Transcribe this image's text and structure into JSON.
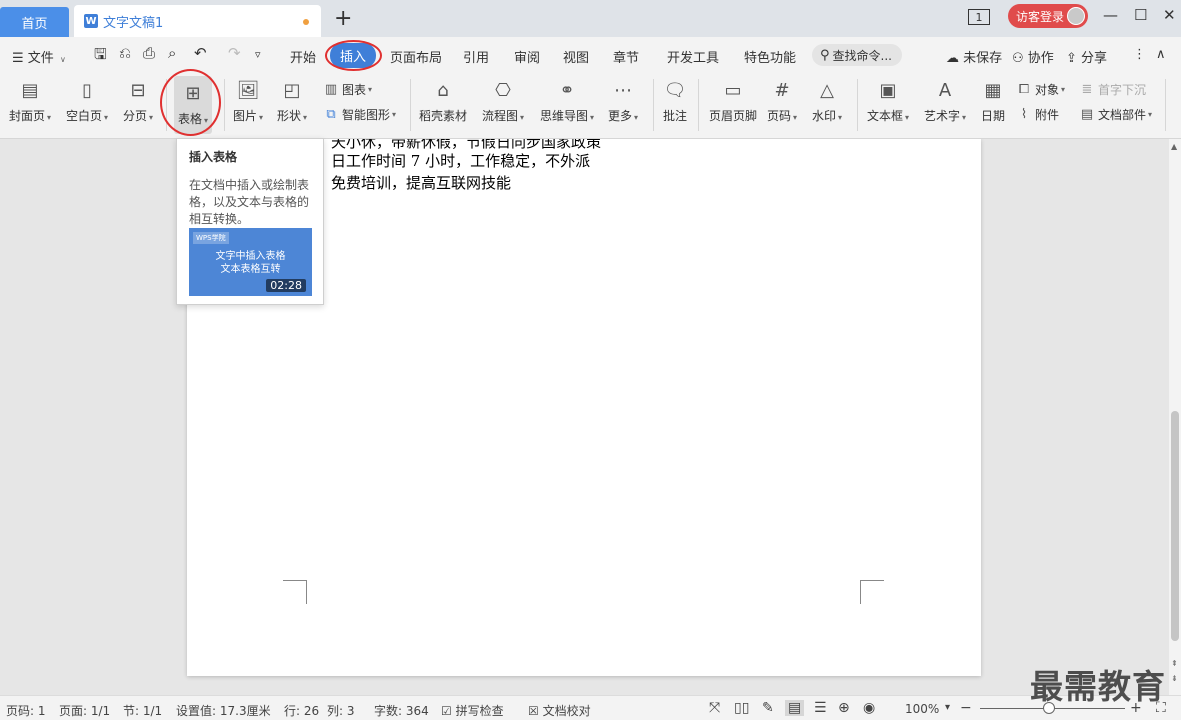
{
  "titlebar": {
    "home_tab": "首页",
    "doc_tab": "文字文稿1",
    "doc_logo": "W",
    "badge": "1",
    "login_label": "访客登录"
  },
  "menubar": {
    "file": "文件",
    "items": [
      "开始",
      "插入",
      "页面布局",
      "引用",
      "审阅",
      "视图",
      "章节",
      "开发工具",
      "特色功能"
    ],
    "active": "插入",
    "search_placeholder": "查找命令...",
    "unsaved": "未保存",
    "collab": "协作",
    "share": "分享"
  },
  "ribbon": {
    "cover": "封面页",
    "blank": "空白页",
    "break": "分页",
    "table": "表格",
    "picture": "图片",
    "shape": "形状",
    "chart": "图表",
    "smart": "智能图形",
    "material": "稻壳素材",
    "flow": "流程图",
    "mind": "思维导图",
    "more": "更多",
    "comment": "批注",
    "header": "页眉页脚",
    "pagenum": "页码",
    "watermark": "水印",
    "textbox": "文本框",
    "art": "艺术字",
    "date": "日期",
    "object": "对象",
    "dropcap": "首字下沉",
    "attach": "附件",
    "docpart": "文档部件"
  },
  "document": {
    "lines": [
      "天小休，带薪休假，节假日同步国家政策",
      "日工作时间 7 小时，工作稳定，不外派",
      "免费培训，提高互联网技能"
    ]
  },
  "tooltip": {
    "title": "插入表格",
    "desc": "在文档中插入或绘制表格，以及文本与表格的相互转换。",
    "video_logo": "WPS学院",
    "video_title_1": "文字中插入表格",
    "video_title_2": "文本表格互转",
    "duration": "02:28"
  },
  "statusbar": {
    "page": "页码: 1",
    "pages": "页面: 1/1",
    "section": "节: 1/1",
    "setting": "设置值: 17.3厘米",
    "row": "行: 26",
    "col": "列: 3",
    "words": "字数: 364",
    "spell": "拼写检查",
    "proof": "文档校对",
    "zoom": "100%"
  },
  "watermark_text": "最需教育"
}
